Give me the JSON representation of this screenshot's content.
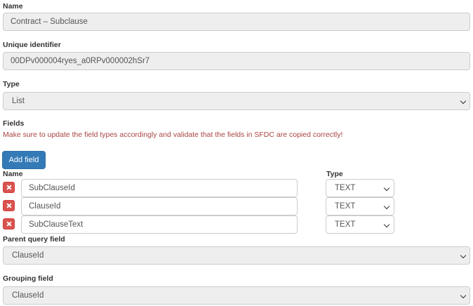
{
  "form": {
    "name_label": "Name",
    "name_value": "Contract – Subclause",
    "uid_label": "Unique identifier",
    "uid_value": "00DPv000004ryes_a0RPv000002hSr7",
    "type_label": "Type",
    "type_value": "List",
    "fields_label": "Fields",
    "fields_warning": "Make sure to update the field types accordingly and validate that the fields in SFDC are copied correctly!",
    "add_field_label": "Add field",
    "col_name_label": "Name",
    "col_type_label": "Type",
    "rows": [
      {
        "name": "SubClauseId",
        "type": "TEXT"
      },
      {
        "name": "ClauseId",
        "type": "TEXT"
      },
      {
        "name": "SubClauseText",
        "type": "TEXT"
      }
    ],
    "parent_query_label": "Parent query field",
    "parent_query_value": "ClauseId",
    "grouping_label": "Grouping field",
    "grouping_value": "ClauseId"
  },
  "icons": {
    "delete": "close-icon",
    "dropdown": "chevron-down-icon"
  },
  "colors": {
    "primary": "#337ab7",
    "danger": "#d9534f",
    "warning_text": "#a94442"
  }
}
